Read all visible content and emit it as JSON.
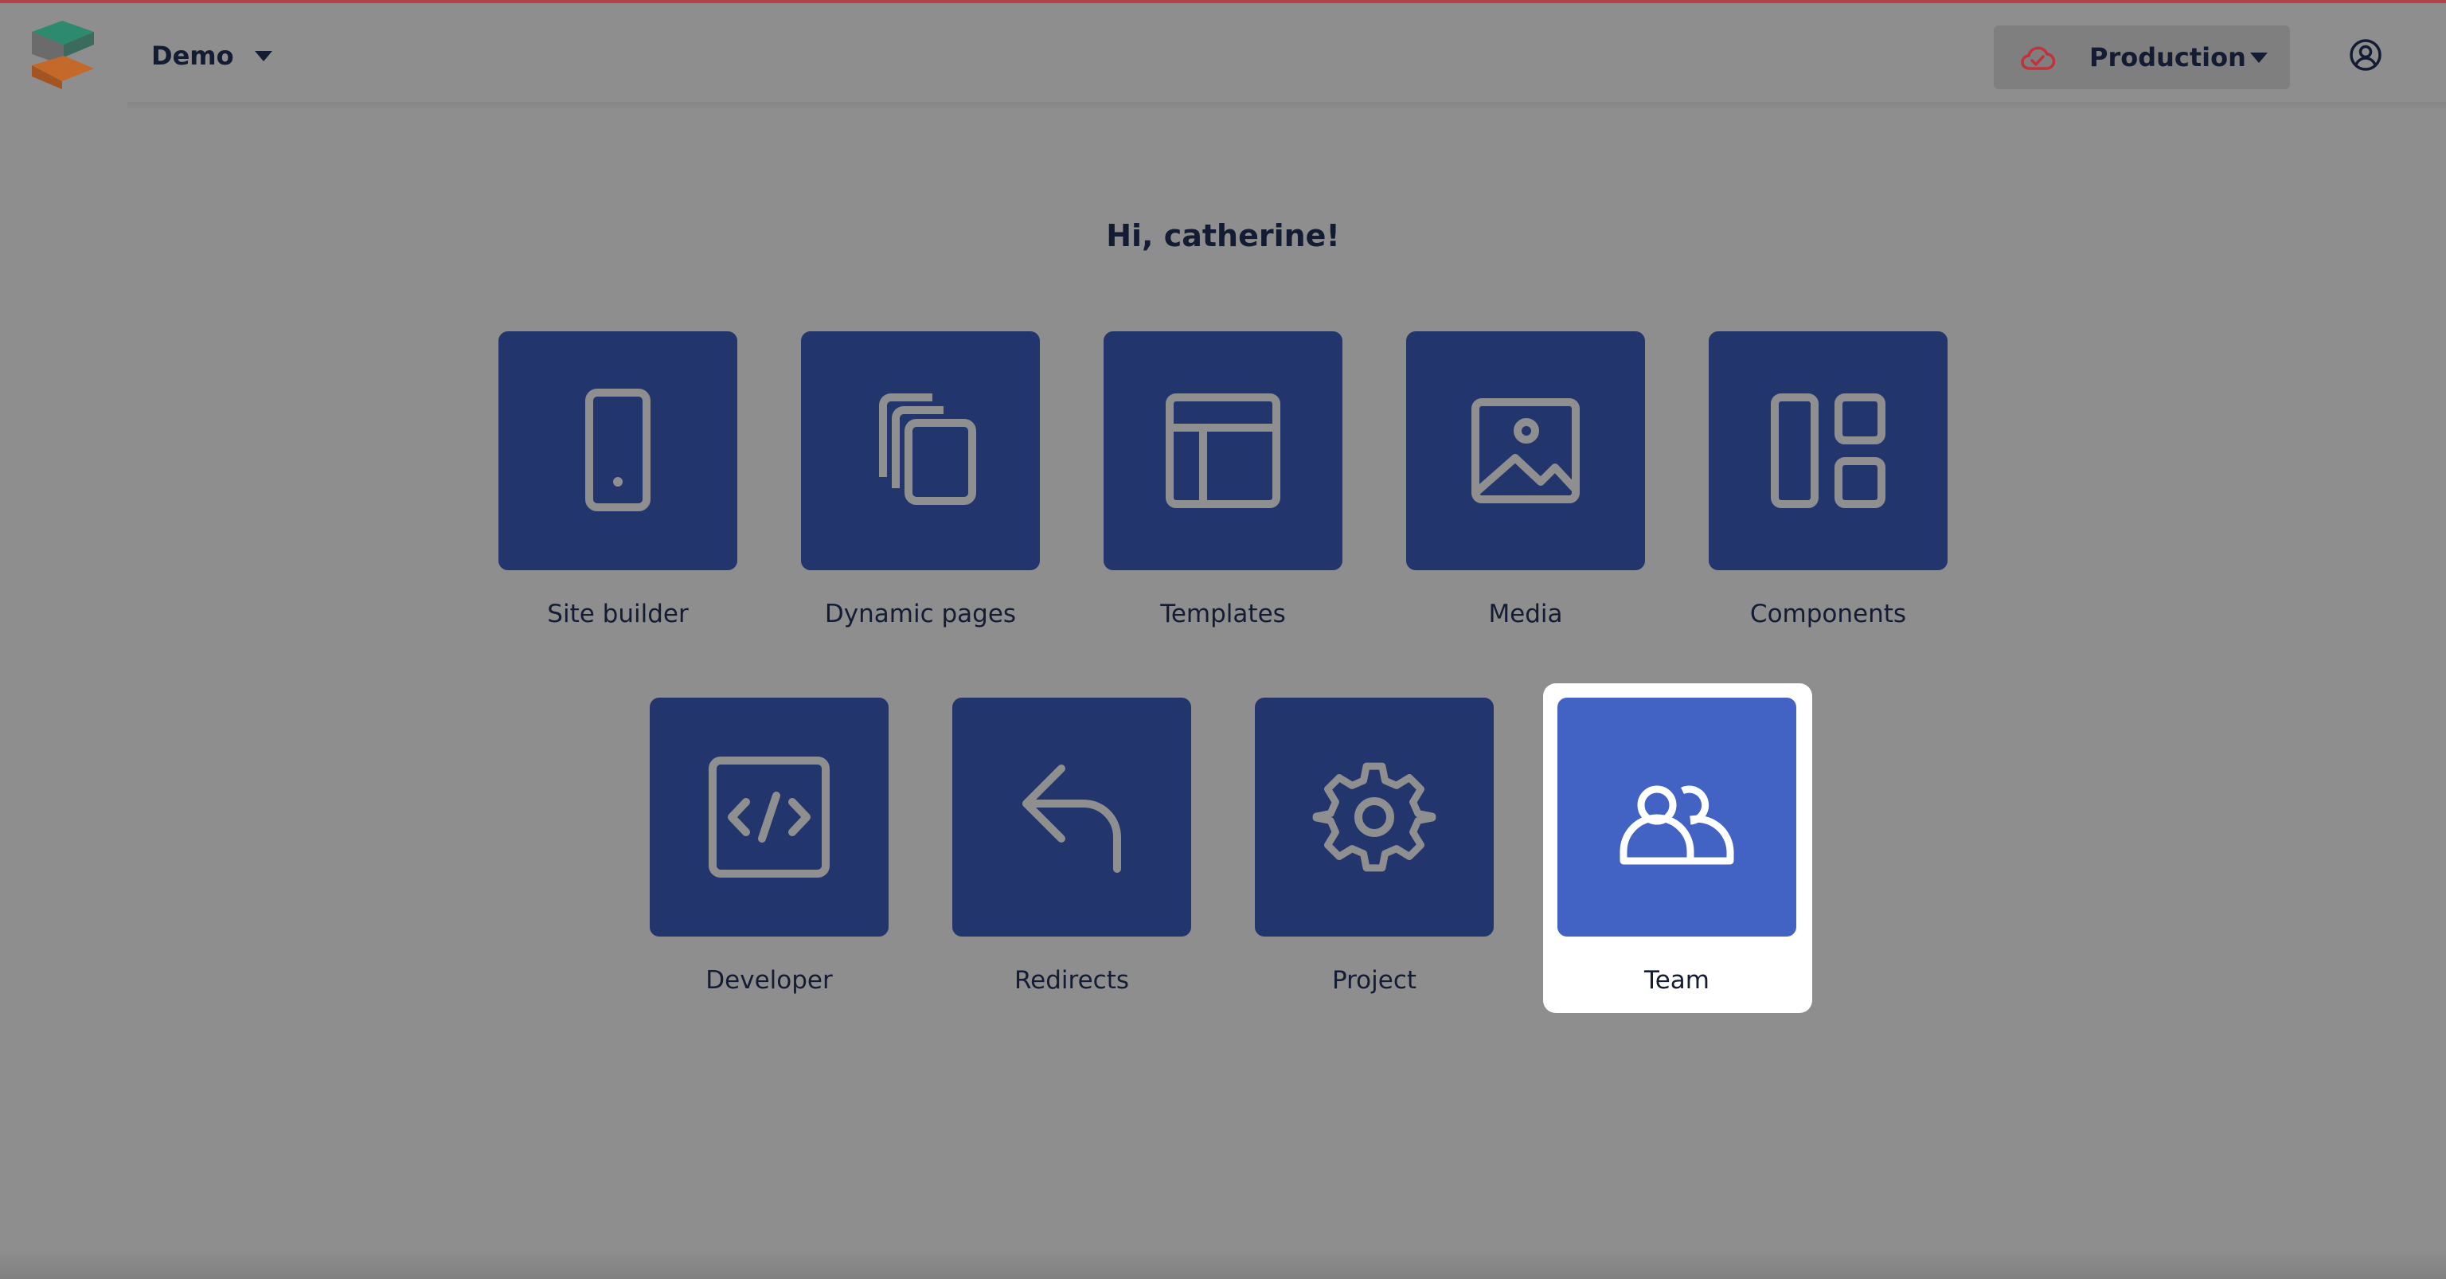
{
  "header": {
    "project_name": "Demo",
    "environment": "Production",
    "colors": {
      "accent_border": "#b2424c",
      "env_icon": "#c2313c"
    }
  },
  "greeting": "Hi, catherine!",
  "tiles": [
    {
      "label": "Site builder",
      "icon": "mobile-icon"
    },
    {
      "label": "Dynamic pages",
      "icon": "stacked-pages-icon"
    },
    {
      "label": "Templates",
      "icon": "layout-icon"
    },
    {
      "label": "Media",
      "icon": "image-icon"
    },
    {
      "label": "Components",
      "icon": "components-icon"
    },
    {
      "label": "Developer",
      "icon": "code-icon"
    },
    {
      "label": "Redirects",
      "icon": "redirect-arrow-icon"
    },
    {
      "label": "Project",
      "icon": "gear-icon"
    },
    {
      "label": "Team",
      "icon": "team-icon",
      "active": true
    }
  ],
  "colors": {
    "tile_bg": "#23356d",
    "tile_active_bg": "#4263c3",
    "icon_stroke": "#8f8f8f",
    "overlay_bg": "#8e8e8e",
    "text": "#141c33"
  }
}
